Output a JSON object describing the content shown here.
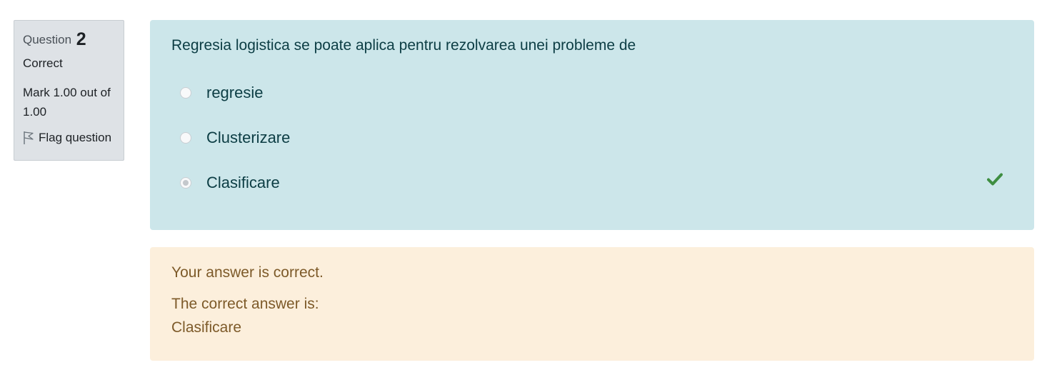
{
  "question_info": {
    "label": "Question",
    "number": "2",
    "state": "Correct",
    "grade": "Mark 1.00 out of 1.00",
    "flag_label": "Flag question"
  },
  "formulation": {
    "question_text": "Regresia logistica se poate aplica pentru rezolvarea unei probleme de",
    "answers": [
      {
        "label": "regresie",
        "selected": false
      },
      {
        "label": "Clusterizare",
        "selected": false
      },
      {
        "label": "Clasificare",
        "selected": true,
        "correct": true
      }
    ],
    "correct_icon": "check-icon"
  },
  "feedback": {
    "general": "Your answer is correct.",
    "right_answer_label": "The correct answer is:",
    "right_answer_value": "Clasificare"
  },
  "colors": {
    "formulation_bg": "#cce6ea",
    "feedback_bg": "#fcefdc",
    "info_bg": "#dee2e6",
    "correct_green": "#3e8e41"
  }
}
